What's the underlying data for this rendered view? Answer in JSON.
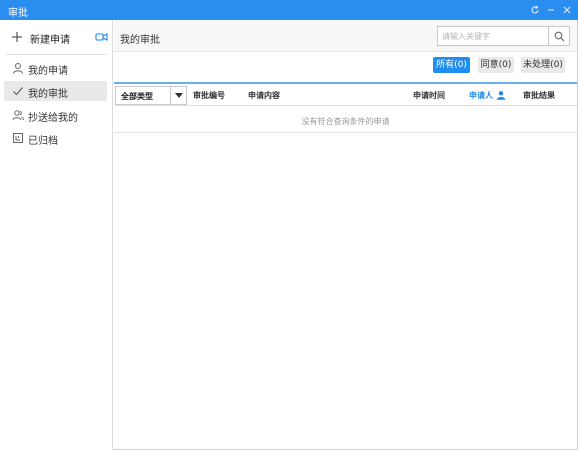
{
  "window": {
    "title": "审批",
    "accent_color": "#2a8ef0",
    "controls": [
      "refresh-icon",
      "minimize-icon",
      "close-icon"
    ]
  },
  "sidebar": {
    "new_request_label": "新建申请",
    "new_request_icon": "plus-icon",
    "video_icon": "video-camera-icon",
    "items": [
      {
        "label": "我的申请",
        "icon": "user-icon",
        "active": false
      },
      {
        "label": "我的审批",
        "icon": "check-icon",
        "active": true
      },
      {
        "label": "抄送给我的",
        "icon": "users-icon",
        "active": false
      },
      {
        "label": "已归档",
        "icon": "archive-icon",
        "active": false
      }
    ]
  },
  "main": {
    "heading": "我的审批",
    "search": {
      "placeholder": "请输入关键字",
      "value": ""
    },
    "filters": [
      {
        "label": "所有(0)",
        "active": true
      },
      {
        "label": "同意(0)",
        "active": false
      },
      {
        "label": "未处理(0)",
        "active": false
      }
    ],
    "table": {
      "type_select_value": "全部类型",
      "columns": [
        "审批编号",
        "申请内容",
        "申请时间",
        "申请人",
        "审批结果"
      ],
      "empty_message": "没有符合查询条件的申请"
    }
  }
}
